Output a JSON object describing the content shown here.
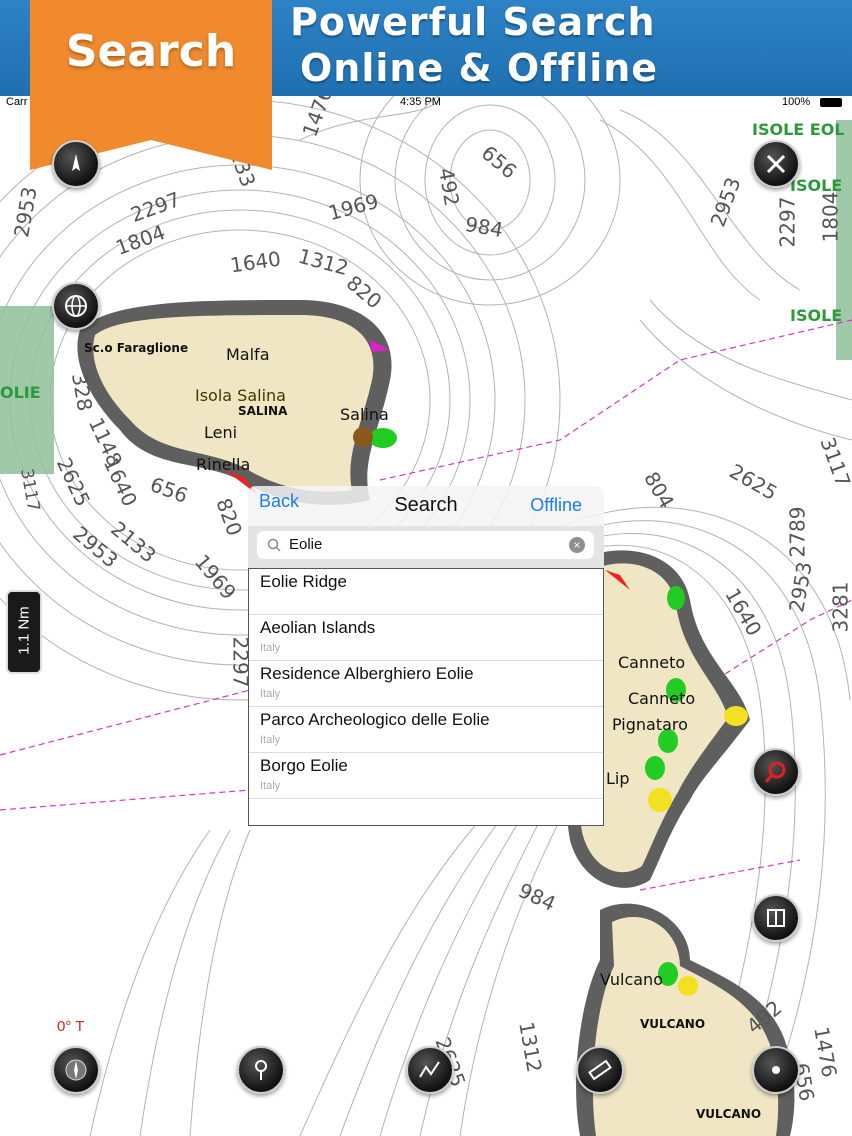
{
  "banner": {
    "ribbon_label": "Search",
    "title_line1": "Powerful Search",
    "title_line2": "Online & Offline"
  },
  "status_bar": {
    "carrier": "Carr",
    "time": "4:35 PM",
    "battery": "100%"
  },
  "map": {
    "place_labels": {
      "faraglione": "Sc.o Faraglione",
      "malfa": "Malfa",
      "isola_salina": "Isola Salina",
      "salina_caps": "SALINA",
      "salina": "Salina",
      "leni": "Leni",
      "rinella": "Rinella",
      "canneto1": "Canneto",
      "canneto2": "Canneto",
      "pignataro": "Pignataro",
      "lipari_partial": "Lip",
      "vulcano_town": "Vulcano",
      "vulcano1": "VULCANO",
      "vulcano2": "VULCANO",
      "isole_eolie": "ISOLE EOL",
      "isole1": "ISOLE",
      "isole2": "ISOLE",
      "olie": "OLIE"
    },
    "depths": [
      "1476",
      "2133",
      "3117",
      "2953",
      "2297",
      "1804",
      "1969",
      "1640",
      "1312",
      "820",
      "656",
      "492",
      "984",
      "2953",
      "2297",
      "1804",
      "3281",
      "3117",
      "2625",
      "2789",
      "2953",
      "3281",
      "1640",
      "804",
      "984",
      "1312",
      "2625",
      "3281",
      "492",
      "1476",
      "656",
      "1148",
      "1640",
      "2625",
      "2133",
      "2953",
      "1969",
      "2297",
      "820",
      "656",
      "3281",
      "3117",
      "328",
      "2625"
    ],
    "accent_colors": {
      "land": "#f0e6c4",
      "shallow": "#bcd8e8",
      "green_zone": "#8fc09a",
      "boundary": "#d636c8"
    }
  },
  "popover": {
    "back_label": "Back",
    "title": "Search",
    "offline_label": "Offline",
    "search_value": "Eolie",
    "results": [
      {
        "title": "Eolie Ridge",
        "subtitle": ""
      },
      {
        "title": "Aeolian Islands",
        "subtitle": "Italy"
      },
      {
        "title": "Residence Alberghiero Eolie",
        "subtitle": "Italy"
      },
      {
        "title": "Parco Archeologico delle Eolie",
        "subtitle": "Italy"
      },
      {
        "title": "Borgo Eolie",
        "subtitle": "Italy"
      }
    ]
  },
  "controls": {
    "heading": "0° T",
    "scale": "1.1 Nm",
    "icons": [
      "compass-nav-icon",
      "tools-icon",
      "globe-icon",
      "search-magnifier-icon",
      "book-icon",
      "compass-rose-icon",
      "pin-icon",
      "route-icon",
      "ruler-icon",
      "location-icon"
    ]
  }
}
